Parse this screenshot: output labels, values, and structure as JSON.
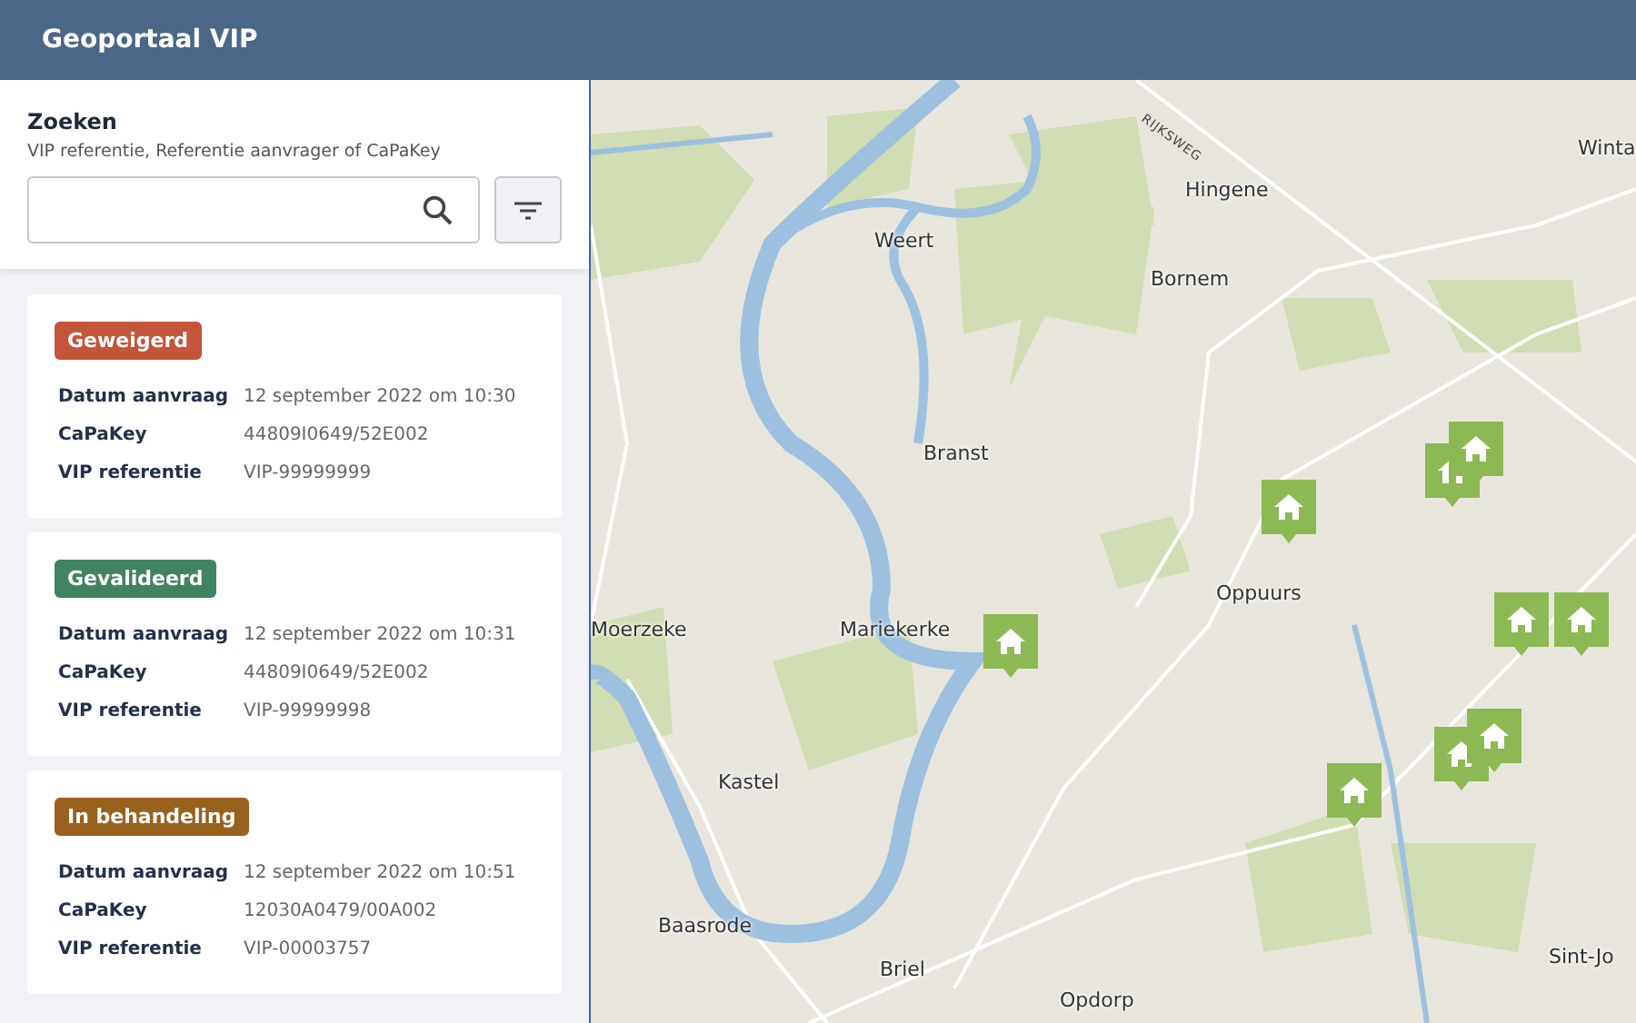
{
  "header": {
    "title": "Geoportaal VIP"
  },
  "search": {
    "title": "Zoeken",
    "hint": "VIP referentie, Referentie aanvrager of CaPaKey"
  },
  "results": [
    {
      "status": {
        "label": "Geweigerd",
        "kind": "rejected"
      },
      "fields": [
        {
          "label": "Datum aanvraag",
          "value": "12 september 2022 om 10:30"
        },
        {
          "label": "CaPaKey",
          "value": "44809I0649/52E002"
        },
        {
          "label": "VIP referentie",
          "value": "VIP-99999999"
        }
      ]
    },
    {
      "status": {
        "label": "Gevalideerd",
        "kind": "validated"
      },
      "fields": [
        {
          "label": "Datum aanvraag",
          "value": "12 september 2022 om 10:31"
        },
        {
          "label": "CaPaKey",
          "value": "44809I0649/52E002"
        },
        {
          "label": "VIP referentie",
          "value": "VIP-99999998"
        }
      ]
    },
    {
      "status": {
        "label": "In behandeling",
        "kind": "pending"
      },
      "fields": [
        {
          "label": "Datum aanvraag",
          "value": "12 september 2022 om 10:51"
        },
        {
          "label": "CaPaKey",
          "value": "12030A0479/00A002"
        },
        {
          "label": "VIP referentie",
          "value": "VIP-00003757"
        }
      ]
    }
  ],
  "map": {
    "road_label": "RIJKSWEG",
    "places": [
      "Weert",
      "Hingene",
      "Winta",
      "Bornem",
      "Branst",
      "Oppuurs",
      "Moerzeke",
      "Mariekerke",
      "Kastel",
      "Baasrode",
      "Briel",
      "Sint-Jo",
      "Opdorp"
    ]
  }
}
